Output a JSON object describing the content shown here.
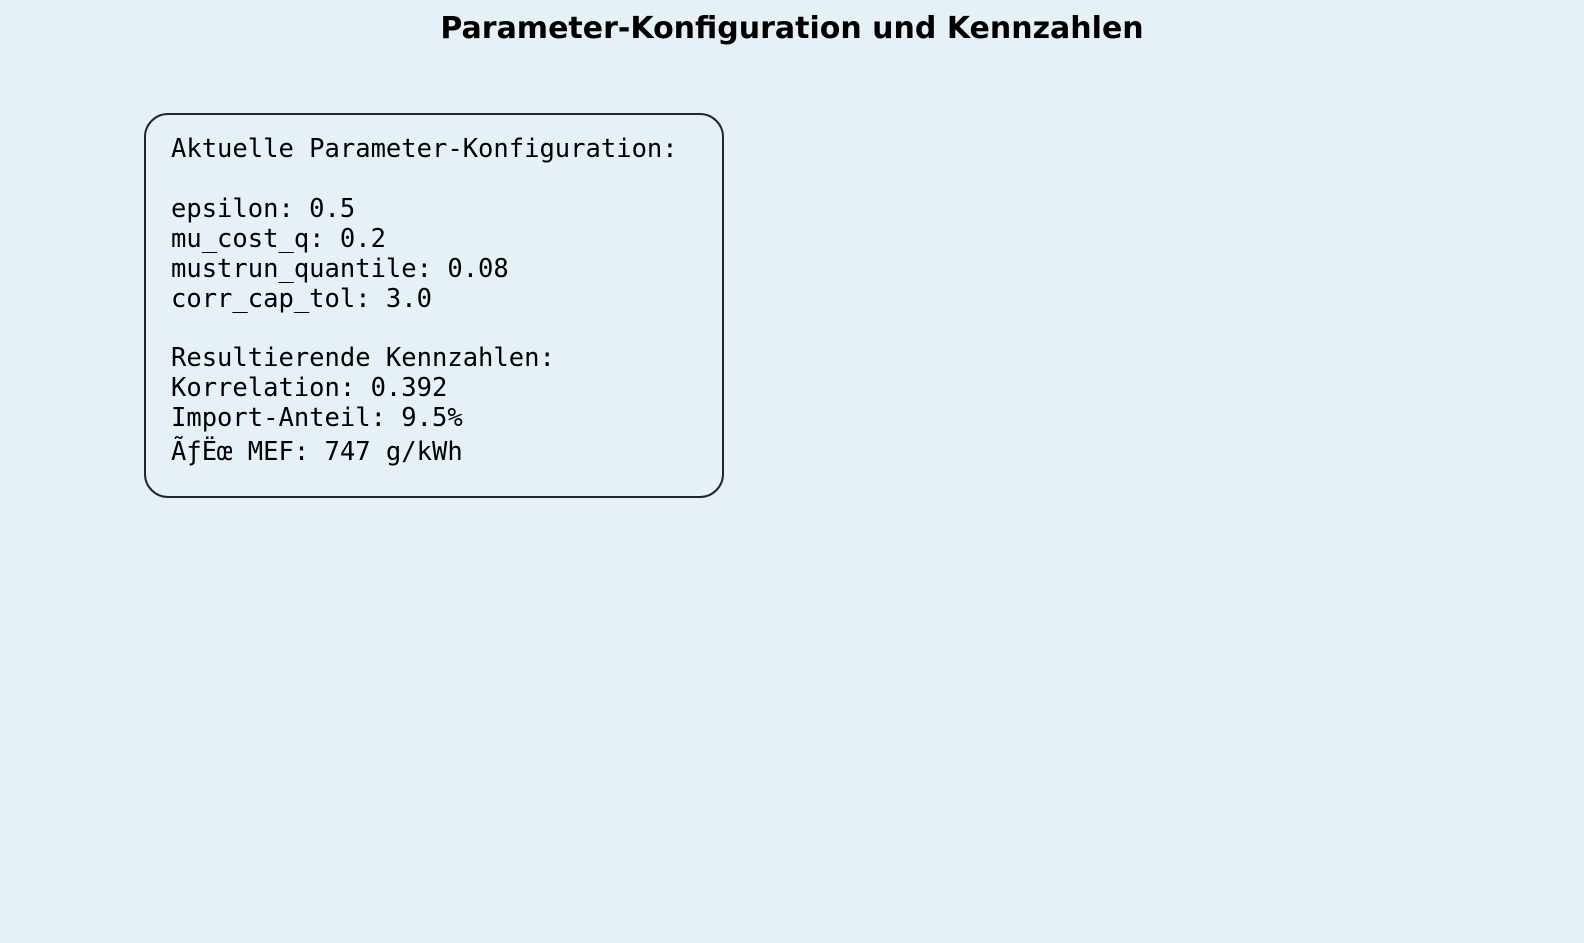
{
  "title": "Parameter-Konfiguration und Kennzahlen",
  "config": {
    "heading": "Aktuelle Parameter-Konfiguration:",
    "lines": [
      "epsilon: 0.5",
      "mu_cost_q: 0.2",
      "mustrun_quantile: 0.08",
      "corr_cap_tol: 3.0"
    ]
  },
  "metrics": {
    "heading": "Resultierende Kennzahlen:",
    "lines": [
      "Korrelation: 0.392",
      "Import-Anteil: 9.5%",
      "ÃƒËœ MEF: 747 g/kWh"
    ]
  },
  "colors": {
    "background": "#e5f0f7",
    "box_border": "#262626",
    "text": "#000000"
  }
}
